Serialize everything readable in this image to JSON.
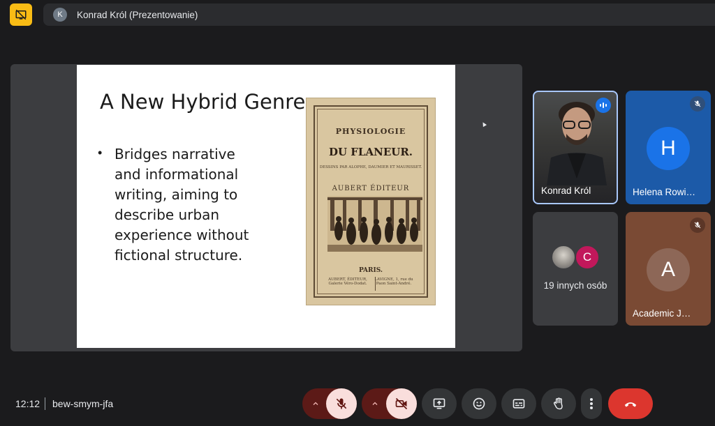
{
  "top_bar": {
    "presenter_initial": "K",
    "presenter_label": "Konrad Król (Prezentowanie)"
  },
  "slide": {
    "title": "A New Hybrid Genre",
    "bullet": "Bridges narrative and informational writing, aiming to describe urban experience without fictional structure.",
    "book": {
      "line1": "PHYSIOLOGIE",
      "line2": "DU FLANEUR.",
      "line3": "DESSINS PAR ALOPHE, DAUMIER ET MAURISSET.",
      "line4": "AUBERT ÉDITEUR",
      "line5": "PARIS.",
      "line6": "AUBERT, ÉDITEUR, Galerie Véro-Dodat.",
      "line7": "LAVIGNE, 1, rue du Paon Saint-André."
    }
  },
  "participants": [
    {
      "name": "Konrad Król",
      "state": "speaking"
    },
    {
      "name": "Helena Rowi…",
      "initial": "H",
      "state": "muted"
    },
    {
      "name": "Academic J…",
      "initial": "A",
      "state": "muted"
    }
  ],
  "others": {
    "initial": "C",
    "label": "19 innych osób"
  },
  "bottom_bar": {
    "time": "12:12",
    "meeting_code": "bew-smym-jfa"
  },
  "colors": {
    "background": "#1b1b1d",
    "accent_yellow": "#f9bc15",
    "end_call_red": "#dc362e",
    "muted_control_bg": "#f9dedc",
    "speaking_blue": "#1a73e8"
  },
  "icons": {
    "app": "presentation-off-icon",
    "mic": "mic-off-icon",
    "camera": "videocam-off-icon",
    "present": "present-screen-icon",
    "emoji": "emoji-icon",
    "captions": "captions-icon",
    "hand": "raise-hand-icon",
    "more": "more-vert-icon",
    "end": "call-end-icon"
  }
}
